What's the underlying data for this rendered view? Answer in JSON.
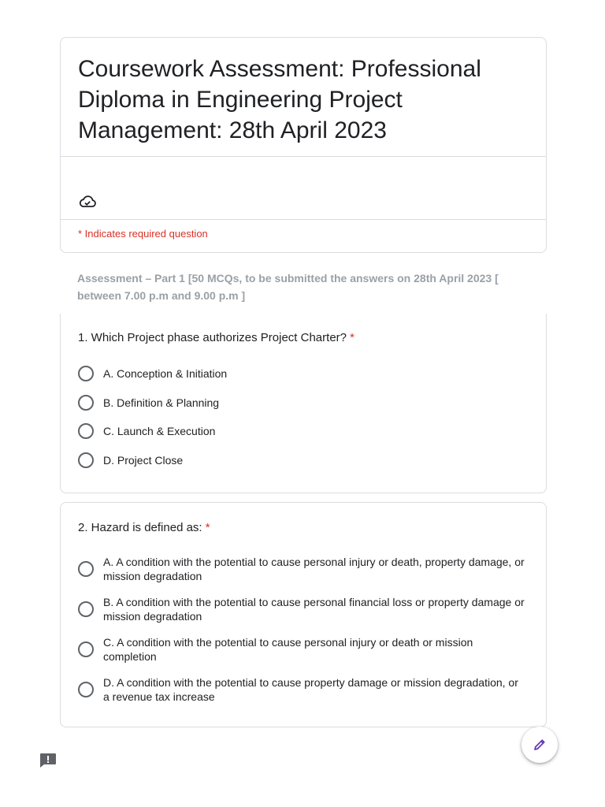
{
  "form": {
    "title": "Coursework Assessment: Professional Diploma in Engineering Project Management:  28th April 2023",
    "required_note": "* Indicates required question",
    "section_description": "Assessment – Part 1 [50 MCQs, to be submitted the answers on 28th April 2023 [ between 7.00 p.m and 9.00 p.m  ]"
  },
  "questions": [
    {
      "text": "1. Which Project phase authorizes Project Charter?",
      "required_mark": "*",
      "options": [
        "A. Conception & Initiation",
        "B. Definition & Planning",
        "C. Launch & Execution",
        "D. Project Close"
      ]
    },
    {
      "text": "2. Hazard is defined as:",
      "required_mark": "*",
      "options": [
        "A. A condition with the potential to cause personal injury or death, property damage, or mission degradation",
        "B. A condition with the potential to cause personal financial loss or property damage or mission degradation",
        "C. A condition with the potential to cause personal injury or death or mission completion",
        "D. A condition with the potential to cause property damage or mission degradation, or a revenue tax increase"
      ]
    }
  ],
  "icons": {
    "cloud": "cloud-check-icon",
    "report": "report-problem-icon",
    "edit": "pencil-edit-icon"
  },
  "colors": {
    "required": "#d93025",
    "accent": "#673ab7",
    "section_text": "#9aa0a6"
  }
}
